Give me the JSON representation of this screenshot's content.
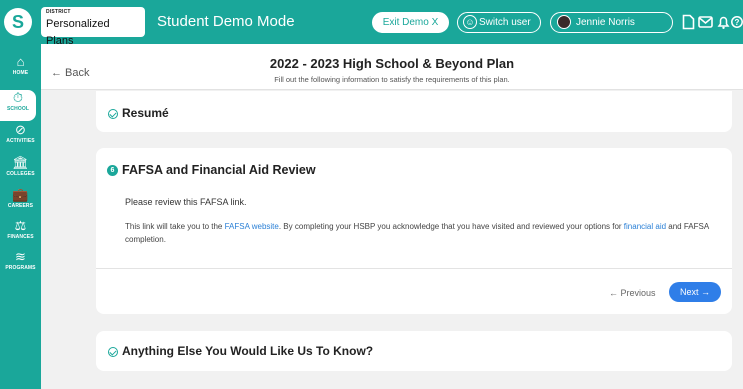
{
  "topbar": {
    "logo_glyph": "S",
    "district_label": "DISTRICT",
    "district_name": "Personalized Plans",
    "mode_title": "Student Demo Mode",
    "exit_demo_label": "Exit Demo X",
    "switch_user_label": "Switch user",
    "user_name": "Jennie Norris",
    "icons": [
      "document-icon",
      "mail-icon",
      "bell-icon",
      "help-icon"
    ]
  },
  "sidebar": {
    "items": [
      {
        "label": "HOME",
        "icon": "home-icon",
        "glyph": "⌂"
      },
      {
        "label": "SCHOOL",
        "icon": "school-icon",
        "glyph": "⏱"
      },
      {
        "label": "ACTIVITIES",
        "icon": "activities-icon",
        "glyph": "⊘"
      },
      {
        "label": "COLLEGES",
        "icon": "colleges-icon",
        "glyph": "🏛"
      },
      {
        "label": "CAREERS",
        "icon": "careers-icon",
        "glyph": "💼"
      },
      {
        "label": "FINANCES",
        "icon": "finances-icon",
        "glyph": "⚖"
      },
      {
        "label": "PROGRAMS",
        "icon": "programs-icon",
        "glyph": "≋"
      }
    ]
  },
  "header": {
    "back_label": "← Back",
    "title": "2022 - 2023 High School & Beyond Plan",
    "subtitle": "Fill out the following information to satisfy the requirements of this plan."
  },
  "sections": {
    "resume_title": "Resumé",
    "fafsa": {
      "step": "6",
      "title": "FAFSA and Financial Aid Review",
      "instruction": "Please review this FAFSA link.",
      "body_pre": "This link will take you to the ",
      "link1": "FAFSA website",
      "body_mid": ". By completing your HSBP you acknowledge that you have visited and reviewed your options for ",
      "link2": "financial aid",
      "body_post": " and FAFSA completion.",
      "previous_label": "← Previous",
      "next_label": "Next →"
    },
    "else_title": "Anything Else You Would Like Us To Know?"
  },
  "colors": {
    "brand": "#1aa79a",
    "link": "#2b80d6",
    "next_button": "#2f7ee8"
  }
}
